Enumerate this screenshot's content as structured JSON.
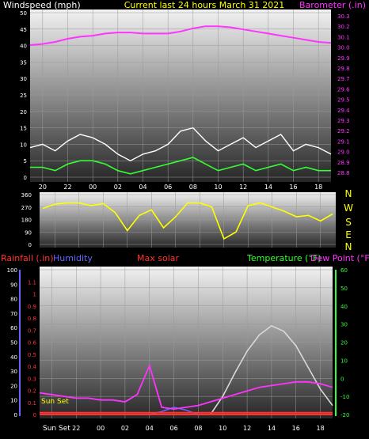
{
  "header": {
    "left_label": "Windspeed (mph)",
    "center_label": "Current last 24 hours March 31 2021",
    "right_label": "Barometer (.in)"
  },
  "colors": {
    "background": "#000000",
    "wind_label": "#ffffff",
    "title": "#ffff00",
    "barometer": "#ff33ff",
    "gust": "#ffffff",
    "wind_avg": "#33ff33",
    "wind_dir": "#ffff00",
    "rain": "#ff3333",
    "humidity": "#6666ff",
    "solar": "#d9d9d9",
    "temperature": "#ff33ff",
    "dewpoint": "#ff3333",
    "temp_axis": "#33ff33"
  },
  "chart_data": [
    {
      "type": "line",
      "title": "Current last 24 hours March 31 2021",
      "xlabel": "",
      "x_ticks": [
        "20",
        "22",
        "00",
        "02",
        "04",
        "06",
        "08",
        "10",
        "12",
        "14",
        "16",
        "18"
      ],
      "x_hours": [
        19,
        43
      ],
      "y_left": {
        "label": "Windspeed (mph)",
        "range": [
          0,
          50
        ],
        "ticks": [
          0,
          5,
          10,
          15,
          20,
          25,
          30,
          35,
          40,
          45,
          50
        ]
      },
      "y_right": {
        "label": "Barometer (.in)",
        "range": [
          28.8,
          30.3
        ],
        "ticks": [
          28.8,
          28.9,
          29.0,
          29.1,
          29.2,
          29.3,
          29.4,
          29.5,
          29.6,
          29.7,
          29.8,
          29.9,
          30.0,
          30.1,
          30.2,
          30.3
        ]
      },
      "series": [
        {
          "name": "Barometer (.in)",
          "axis": "right",
          "x": [
            19,
            20,
            21,
            22,
            23,
            24,
            25,
            26,
            27,
            28,
            29,
            30,
            31,
            32,
            33,
            34,
            35,
            36,
            37,
            38,
            39,
            40,
            41,
            42,
            43
          ],
          "y": [
            30.02,
            30.03,
            30.05,
            30.08,
            30.1,
            30.11,
            30.13,
            30.14,
            30.14,
            30.13,
            30.13,
            30.13,
            30.15,
            30.18,
            30.2,
            30.2,
            30.19,
            30.17,
            30.15,
            30.13,
            30.11,
            30.09,
            30.07,
            30.05,
            30.04
          ]
        },
        {
          "name": "Wind gust",
          "axis": "left",
          "x": [
            19,
            20,
            21,
            22,
            23,
            24,
            25,
            26,
            27,
            28,
            29,
            30,
            31,
            32,
            33,
            34,
            35,
            36,
            37,
            38,
            39,
            40,
            41,
            42,
            43
          ],
          "y": [
            9,
            10,
            8,
            11,
            13,
            12,
            10,
            7,
            5,
            7,
            8,
            10,
            14,
            15,
            11,
            8,
            10,
            12,
            9,
            11,
            13,
            8,
            10,
            9,
            7
          ]
        },
        {
          "name": "Wind average",
          "axis": "left",
          "x": [
            19,
            20,
            21,
            22,
            23,
            24,
            25,
            26,
            27,
            28,
            29,
            30,
            31,
            32,
            33,
            34,
            35,
            36,
            37,
            38,
            39,
            40,
            41,
            42,
            43
          ],
          "y": [
            3,
            3,
            2,
            4,
            5,
            5,
            4,
            2,
            1,
            2,
            3,
            4,
            5,
            6,
            4,
            2,
            3,
            4,
            2,
            3,
            4,
            2,
            3,
            2,
            2
          ]
        }
      ]
    },
    {
      "type": "scatter",
      "title": "",
      "x_hours": [
        19,
        43
      ],
      "y_left": {
        "range": [
          0,
          360
        ],
        "ticks": [
          0,
          90,
          180,
          270,
          360
        ]
      },
      "compass_labels": [
        "N",
        "W",
        "S",
        "E",
        "N"
      ],
      "series": [
        {
          "name": "Wind direction",
          "x": [
            19,
            20,
            21,
            22,
            23,
            24,
            25,
            26,
            27,
            28,
            29,
            30,
            31,
            32,
            33,
            34,
            35,
            36,
            37,
            38,
            39,
            40,
            41,
            42,
            43
          ],
          "y": [
            260,
            290,
            300,
            300,
            280,
            295,
            230,
            100,
            210,
            250,
            120,
            200,
            300,
            300,
            270,
            40,
            90,
            280,
            300,
            270,
            240,
            200,
            210,
            170,
            220
          ]
        }
      ]
    },
    {
      "type": "line",
      "title": "",
      "x_hours": [
        19,
        43
      ],
      "legend": [
        "Rainfall (.in)",
        "Humidity",
        "Max solar",
        "Temperature (°F)",
        "Dew Point (°F)"
      ],
      "annotations": [
        "Sun Set",
        "Sun Set"
      ],
      "y_left_outer": {
        "label": "Humidity",
        "range": [
          0,
          100
        ],
        "ticks": [
          0,
          10,
          20,
          30,
          40,
          50,
          60,
          70,
          80,
          90,
          100
        ]
      },
      "y_left_inner": {
        "label": "Rainfall (.in)",
        "range": [
          0,
          1.2
        ],
        "ticks": [
          0,
          0.1,
          0.2,
          0.3,
          0.4,
          0.5,
          0.6,
          0.7,
          0.8,
          0.9,
          1,
          1.1
        ]
      },
      "y_right": {
        "label": "Temperature (°F)",
        "range": [
          -20,
          60
        ],
        "ticks": [
          -20,
          -10,
          0,
          10,
          20,
          30,
          40,
          50,
          60
        ]
      },
      "series": [
        {
          "name": "Rainfall (.in)",
          "axis": "left_inner",
          "x": [
            19,
            43
          ],
          "y": [
            0,
            0
          ]
        },
        {
          "name": "Humidity",
          "axis": "left_outer",
          "x": [
            19,
            26,
            27,
            28,
            29,
            30,
            31,
            32,
            33,
            34,
            35,
            36,
            43
          ],
          "y": [
            0,
            0,
            0,
            0,
            2,
            5,
            3,
            0,
            0,
            0,
            0,
            0,
            0
          ]
        },
        {
          "name": "Max solar",
          "axis": "right",
          "x": [
            33,
            34,
            35,
            36,
            37,
            38,
            39,
            40,
            41,
            42,
            43
          ],
          "y": [
            -20,
            -10,
            3,
            15,
            24,
            29,
            26,
            18,
            6,
            -6,
            -15
          ]
        },
        {
          "name": "Temperature (°F)",
          "axis": "right",
          "x": [
            19,
            20,
            21,
            22,
            23,
            24,
            25,
            26,
            27,
            28,
            29,
            30,
            31,
            32,
            33,
            34,
            35,
            36,
            37,
            38,
            39,
            40,
            41,
            42,
            43
          ],
          "y": [
            -8,
            -9,
            -10,
            -11,
            -11,
            -12,
            -12,
            -13,
            -9,
            7,
            -16,
            -17,
            -16,
            -15,
            -13,
            -11,
            -9,
            -7,
            -5,
            -4,
            -3,
            -2,
            -2,
            -3,
            -5
          ]
        },
        {
          "name": "Dew Point (°F)",
          "axis": "right",
          "x": [
            19,
            43
          ],
          "y": [
            -19,
            -19
          ]
        }
      ]
    }
  ]
}
